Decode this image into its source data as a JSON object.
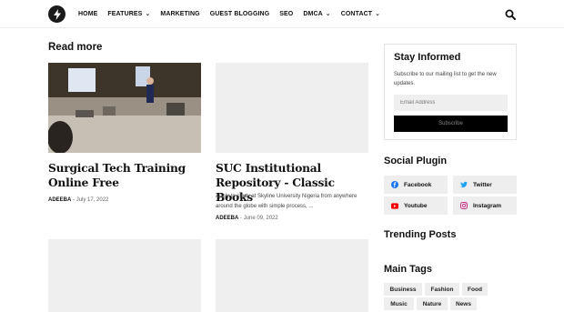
{
  "nav": {
    "items": [
      {
        "label": "HOME",
        "dropdown": false
      },
      {
        "label": "FEATURES",
        "dropdown": true
      },
      {
        "label": "MARKETING",
        "dropdown": false
      },
      {
        "label": "GUEST BLOGGING",
        "dropdown": false
      },
      {
        "label": "SEO",
        "dropdown": false
      },
      {
        "label": "DMCA",
        "dropdown": true
      },
      {
        "label": "CONTACT",
        "dropdown": true
      }
    ],
    "logo_icon": "bolt-icon",
    "search_icon": "search-icon"
  },
  "main": {
    "section_title": "Read more",
    "posts": [
      {
        "title": "Surgical Tech Training Online Free",
        "author": "ADEEBA",
        "date": "July 17, 2022",
        "snippet": ""
      },
      {
        "title": "SUC Institutional Repository - Classic Books",
        "author": "ADEEBA",
        "date": "June 09, 2022",
        "snippet": "Apply to study at Skyline University Nigeria from anywhere around the globe with simple process, ..."
      }
    ]
  },
  "sidebar": {
    "stay_informed": {
      "title": "Stay Informed",
      "text": "Subscribe to our mailing list to get the new updates.",
      "email_placeholder": "Email Address",
      "button": "Subscribe"
    },
    "social": {
      "title": "Social Plugin",
      "items": [
        {
          "label": "Facebook",
          "icon": "facebook-icon",
          "color": "#1877f2"
        },
        {
          "label": "Twitter",
          "icon": "twitter-icon",
          "color": "#1da1f2"
        },
        {
          "label": "Youtube",
          "icon": "youtube-icon",
          "color": "#ff0000"
        },
        {
          "label": "Instagram",
          "icon": "instagram-icon",
          "color": "#c13584"
        }
      ]
    },
    "trending_title": "Trending Posts",
    "tags_title": "Main Tags",
    "tags": [
      "Business",
      "Fashion",
      "Food",
      "Music",
      "Nature",
      "News"
    ]
  }
}
